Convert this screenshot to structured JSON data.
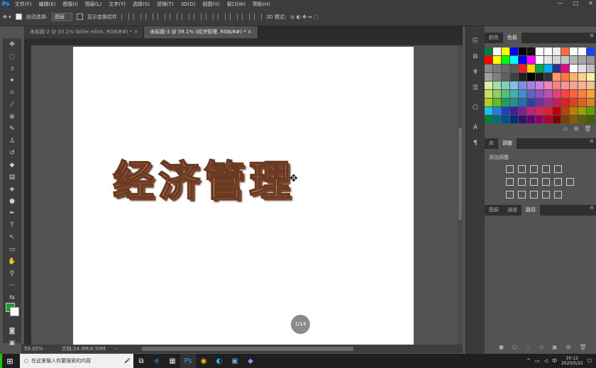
{
  "app": {
    "logo": "Ps"
  },
  "menu": [
    "文件(F)",
    "编辑(E)",
    "图像(I)",
    "图层(L)",
    "文字(Y)",
    "选择(S)",
    "滤镜(T)",
    "3D(D)",
    "视图(V)",
    "窗口(W)",
    "帮助(H)"
  ],
  "window_controls": [
    "—",
    "□",
    "✕"
  ],
  "options": {
    "auto_select_label": "自动选择:",
    "auto_select_value": "图层",
    "transform_label": "显示变换控件",
    "mode_label": "3D 模式:"
  },
  "tabs": [
    {
      "label": "未标题-2 @ 33.1% (billie eilish, RGB/8#) *",
      "close": "×"
    },
    {
      "label": "未标题-3 @ 59.1% (经济管理, RGB/8#) *",
      "close": "×"
    }
  ],
  "canvas": {
    "text": "经济管理",
    "page_indicator": "1/14"
  },
  "status": {
    "zoom": "59.05%",
    "doc": "文档:24.9M/4.50M"
  },
  "panels": {
    "top_tabs": [
      "颜色",
      "色板"
    ],
    "mid_tabs": [
      "库",
      "调整"
    ],
    "adjust_label": "添加调整",
    "bottom_tabs": [
      "图层",
      "通道",
      "路径"
    ]
  },
  "swatch_colors": [
    "#007a3d",
    "#ffffff",
    "#ffff00",
    "#0000ff",
    "#000000",
    "#111111",
    "#ffffff",
    "#ffffff",
    "#eeeeee",
    "#ff6a3d",
    "#ffffff",
    "#ffffff",
    "#1f3cff",
    "#ff0000",
    "#ffff00",
    "#00ff00",
    "#00ffff",
    "#0000ff",
    "#ff00ff",
    "#ffffff",
    "#e6e6e6",
    "#d6d6d6",
    "#c6c6c6",
    "#b6b6b6",
    "#a6a6a6",
    "#969696",
    "#888888",
    "#7a7a7a",
    "#6a6a6a",
    "#5a5a5a",
    "#ff1c1c",
    "#ffd200",
    "#00a651",
    "#00aeef",
    "#2e3192",
    "#ec008c",
    "#ffffff",
    "#e0e0e0",
    "#c0c0c0",
    "#a0a0a0",
    "#808080",
    "#606060",
    "#404040",
    "#202020",
    "#000000",
    "#1a1a1a",
    "#333333",
    "#ff9a6a",
    "#ff7a3a",
    "#ffb36a",
    "#ffd08a",
    "#fff0aa",
    "#d8f0a0",
    "#a0e0a0",
    "#80d0c0",
    "#80c0e0",
    "#8090e0",
    "#a080e0",
    "#d080e0",
    "#f080c0",
    "#ff8080",
    "#ff9090",
    "#ffa090",
    "#ffb090",
    "#ffc090",
    "#c8e060",
    "#90d060",
    "#50c080",
    "#40b0b0",
    "#4090d0",
    "#6060c0",
    "#9050c0",
    "#c050b0",
    "#e04080",
    "#ff4040",
    "#ff6040",
    "#ff8040",
    "#ffa040",
    "#b0d020",
    "#60c020",
    "#20a060",
    "#209090",
    "#2070b0",
    "#3040a0",
    "#7030a0",
    "#a03090",
    "#c02060",
    "#e02020",
    "#e04020",
    "#e06020",
    "#e08020",
    "#20c0e0",
    "#2080e0",
    "#2040c0",
    "#4020a0",
    "#802090",
    "#c02080",
    "#e02050",
    "#e02030",
    "#c00000",
    "#c04000",
    "#c08000",
    "#a0a000",
    "#60a000",
    "#008040",
    "#007070",
    "#005090",
    "#003070",
    "#301070",
    "#600070",
    "#900060",
    "#b00030",
    "#800000",
    "#804000",
    "#806000",
    "#606000",
    "#406000"
  ],
  "taskbar": {
    "search_placeholder": "在这里输入你要搜索的内容",
    "ime": "中",
    "time": "20:12",
    "date": "2020/5/22"
  }
}
